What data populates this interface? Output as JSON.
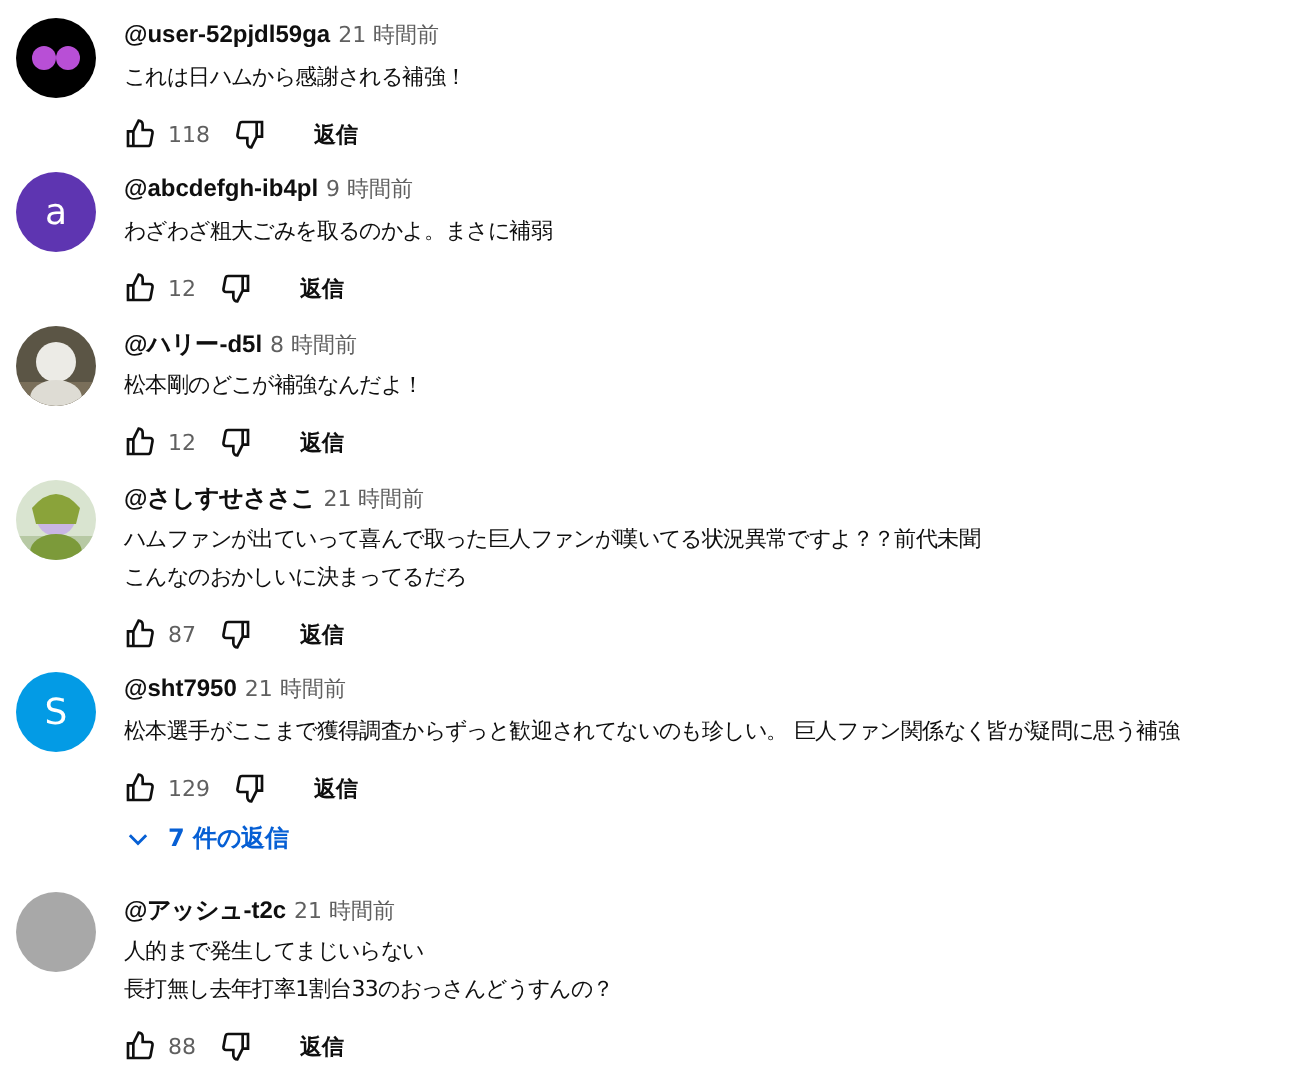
{
  "comments": [
    {
      "avatar": {
        "kind": "dots"
      },
      "handle": "@user-52pjdl59ga",
      "time": "21 時間前",
      "lines": [
        "これは日ハムから感謝される補強！"
      ],
      "likes": "118",
      "reply": "返信"
    },
    {
      "avatar": {
        "kind": "letter",
        "letter": "a",
        "color": "#5e35b1"
      },
      "handle": "@abcdefgh-ib4pl",
      "time": "9 時間前",
      "lines": [
        "わざわざ粗大ごみを取るのかよ。まさに補弱"
      ],
      "likes": "12",
      "reply": "返信"
    },
    {
      "avatar": {
        "kind": "picture"
      },
      "handle": "@ハリー-d5l",
      "time": "8 時間前",
      "lines": [
        "松本剛のどこが補強なんだよ！"
      ],
      "likes": "12",
      "reply": "返信"
    },
    {
      "avatar": {
        "kind": "picture"
      },
      "handle": "@さしすせささこ",
      "time": "21 時間前",
      "lines": [
        "ハムファンが出ていって喜んで取った巨人ファンが嘆いてる状況異常ですよ？？前代未聞",
        "こんなのおかしいに決まってるだろ"
      ],
      "likes": "87",
      "reply": "返信"
    },
    {
      "avatar": {
        "kind": "letter",
        "letter": "S",
        "color": "#039be5"
      },
      "handle": "@sht7950",
      "time": "21 時間前",
      "lines": [
        "松本選手がここまで獲得調査からずっと歓迎されてないのも珍しい。 巨人ファン関係なく皆が疑問に思う補強"
      ],
      "likes": "129",
      "reply": "返信",
      "replies_link": "7 件の返信"
    },
    {
      "avatar": {
        "kind": "blank"
      },
      "handle": "@アッシュ-t2c",
      "time": "21 時間前",
      "lines": [
        "人的まで発生してまじいらない",
        "長打無し去年打率1割台33のおっさんどうすんの？"
      ],
      "likes": "88",
      "reply": "返信"
    }
  ]
}
